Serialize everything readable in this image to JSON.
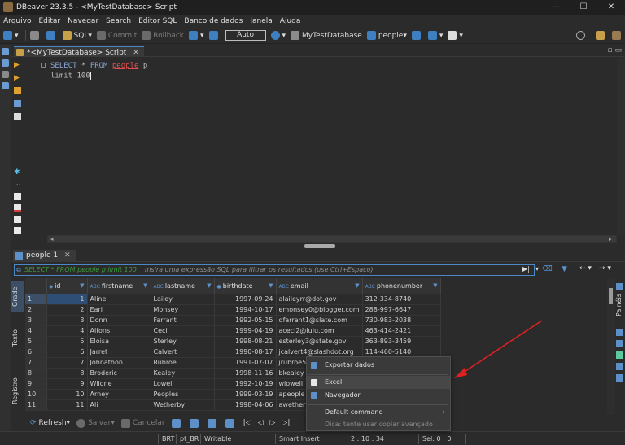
{
  "window": {
    "title": "DBeaver 23.3.5 - <MyTestDatabase> Script",
    "controls": [
      "—",
      "☐",
      "✕"
    ]
  },
  "menu": [
    "Arquivo",
    "Editar",
    "Navegar",
    "Search",
    "Editor SQL",
    "Banco de dados",
    "Janela",
    "Ajuda"
  ],
  "toolbar": {
    "sql_label": "SQL",
    "commit_label": "Commit",
    "rollback_label": "Rollback",
    "transaction_mode": "Auto",
    "datasource": "MyTestDatabase",
    "schema": "people"
  },
  "editor": {
    "tab_label": "*<MyTestDatabase> Script",
    "line1_keyword": "SELECT",
    "line1_star": " * ",
    "line1_from": "FROM",
    "line1_table": "people",
    "line1_alias": " p",
    "line2": "limit 100"
  },
  "results": {
    "tab_label": "people 1",
    "filter_prefix": "SELECT * FROM people p limit 100",
    "filter_placeholder": "Insira uma expressão SQL para filtrar os resultados (use Ctrl+Espaço)",
    "side_tabs": [
      "Grade",
      "Texto",
      "Registro"
    ],
    "right_panel_label": "Painéis",
    "columns": [
      {
        "type": "123",
        "name": "id"
      },
      {
        "type": "ABC",
        "name": "firstname"
      },
      {
        "type": "ABC",
        "name": "lastname"
      },
      {
        "type": "",
        "name": "birthdate"
      },
      {
        "type": "ABC",
        "name": "email"
      },
      {
        "type": "ABC",
        "name": "phonenumber"
      }
    ],
    "rows": [
      [
        "1",
        "1",
        "Aline",
        "Lailey",
        "1997-09-24",
        "alaileyrr@dot.gov",
        "312-334-8740"
      ],
      [
        "2",
        "2",
        "Earl",
        "Monsey",
        "1994-10-17",
        "emonsey0@blogger.com",
        "288-997-6647"
      ],
      [
        "3",
        "3",
        "Donn",
        "Farrant",
        "1992-05-15",
        "dfarrant1@slate.com",
        "730-983-2038"
      ],
      [
        "4",
        "4",
        "Alfons",
        "Ceci",
        "1999-04-19",
        "aceci2@lulu.com",
        "463-414-2421"
      ],
      [
        "5",
        "5",
        "Eloisa",
        "Sterley",
        "1998-08-21",
        "esterley3@state.gov",
        "363-893-3459"
      ],
      [
        "6",
        "6",
        "Jarret",
        "Calvert",
        "1990-08-17",
        "jcalvert4@slashdot.org",
        "114-460-5140"
      ],
      [
        "7",
        "7",
        "Johnathon",
        "Rubroe",
        "1991-07-07",
        "jrubroe5",
        ""
      ],
      [
        "8",
        "8",
        "Broderic",
        "Kealey",
        "1998-11-16",
        "bkealey",
        ""
      ],
      [
        "9",
        "9",
        "Wilone",
        "Lowell",
        "1992-10-19",
        "wlowell",
        ""
      ],
      [
        "10",
        "10",
        "Arney",
        "Peoples",
        "1999-03-19",
        "apeople",
        ""
      ],
      [
        "11",
        "11",
        "Ali",
        "Wetherby",
        "1998-04-06",
        "awether",
        ""
      ]
    ]
  },
  "grid_toolbar": {
    "refresh": "Refresh",
    "save": "Salvar",
    "cancel": "Cancelar"
  },
  "context_menu": {
    "items": [
      {
        "label": "Exportar dados",
        "disabled": false
      },
      {
        "label": "Excel",
        "disabled": false
      },
      {
        "label": "Navegador",
        "disabled": false
      },
      {
        "label": "Default command",
        "disabled": false
      },
      {
        "label": "Dica: tente usar copiar avançado",
        "disabled": true
      }
    ]
  },
  "status": {
    "brt": "BRT",
    "locale": "pt_BR",
    "mode": "Writable",
    "insert": "Smart Insert",
    "position": "2 : 10 : 34",
    "selection": "Sel: 0 | 0"
  },
  "colors": {
    "accent": "#4a88c7",
    "background": "#2b2b2b",
    "annotation": "#e02020"
  }
}
